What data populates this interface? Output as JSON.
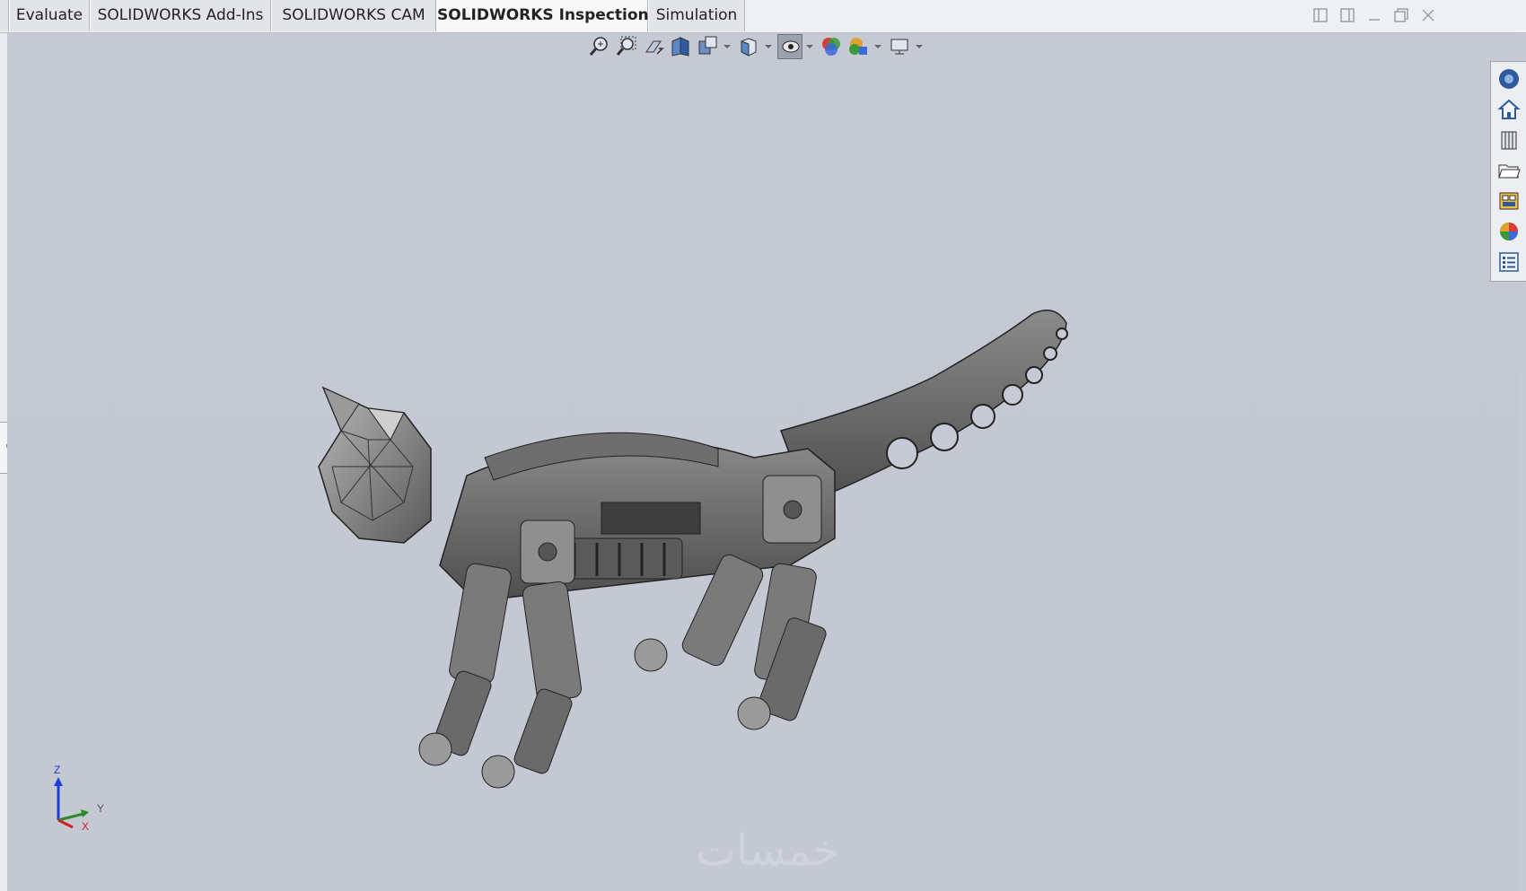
{
  "tabs": [
    {
      "label": "Evaluate"
    },
    {
      "label": "SOLIDWORKS Add-Ins"
    },
    {
      "label": "SOLIDWORKS CAM"
    },
    {
      "label": "SOLIDWORKS Inspection"
    },
    {
      "label": "Simulation"
    }
  ],
  "active_tab": "SOLIDWORKS Inspection",
  "hud_icons": [
    "zoom-to-fit-icon",
    "zoom-to-area-icon",
    "previous-view-icon",
    "section-view-icon",
    "dynamic-annotation-icon",
    "view-orientation-icon",
    "display-style-icon",
    "hide-show-items-icon",
    "edit-appearance-icon",
    "apply-scene-icon",
    "view-settings-icon"
  ],
  "taskpane_icons": [
    "solidworks-resources-icon",
    "home-icon",
    "design-library-icon",
    "file-explorer-icon",
    "view-palette-icon",
    "appearances-scenes-icon",
    "custom-properties-icon"
  ],
  "triad": {
    "z": "Z",
    "y": "Y",
    "x": "X"
  },
  "watermark": "خمسات",
  "colors": {
    "viewport": "#c5c9d3",
    "model_dark": "#4a4a4a",
    "model_mid": "#7a7a7a",
    "model_light": "#a8a8a8",
    "axis_z": "#1a3fd9",
    "axis_y": "#2a8a2a",
    "axis_x": "#d02020"
  }
}
